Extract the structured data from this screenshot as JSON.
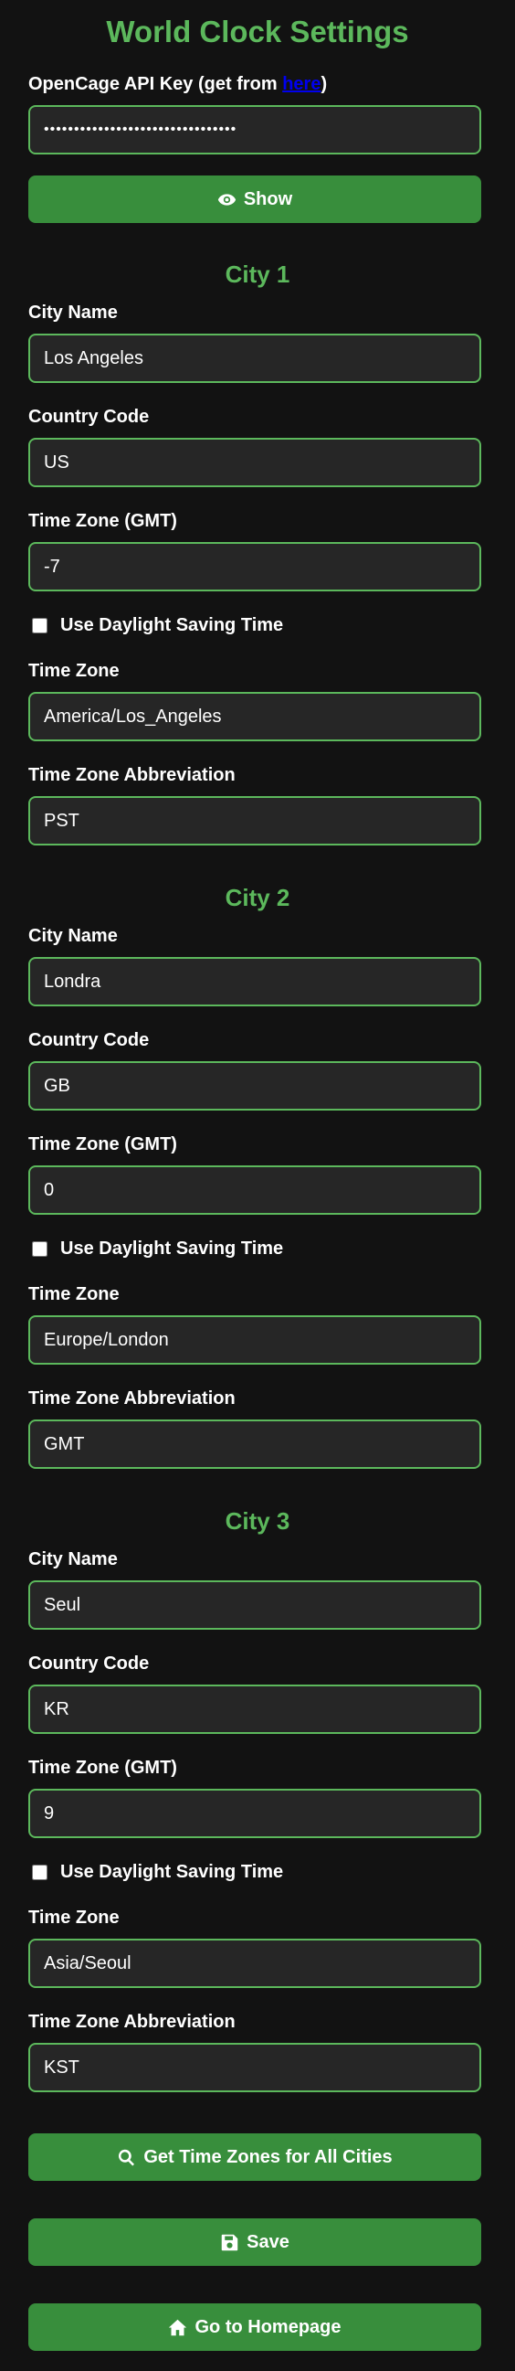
{
  "page": {
    "title": "World Clock Settings"
  },
  "api": {
    "label_prefix": "OpenCage API Key (get from ",
    "link_text": "here",
    "label_suffix": ")",
    "masked_value": "••••••••••••••••••••••••••••••••",
    "show_button": "Show"
  },
  "labels": {
    "city_name": "City Name",
    "country_code": "Country Code",
    "gmt": "Time Zone (GMT)",
    "dst": "Use Daylight Saving Time",
    "time_zone": "Time Zone",
    "abbr": "Time Zone Abbreviation"
  },
  "cities": [
    {
      "heading": "City 1",
      "name": "Los Angeles",
      "country": "US",
      "gmt": "-7",
      "dst": false,
      "timezone": "America/Los_Angeles",
      "abbr": "PST"
    },
    {
      "heading": "City 2",
      "name": "Londra",
      "country": "GB",
      "gmt": "0",
      "dst": false,
      "timezone": "Europe/London",
      "abbr": "GMT"
    },
    {
      "heading": "City 3",
      "name": "Seul",
      "country": "KR",
      "gmt": "9",
      "dst": false,
      "timezone": "Asia/Seoul",
      "abbr": "KST"
    }
  ],
  "actions": {
    "get_zones": "Get Time Zones for All Cities",
    "save": "Save",
    "home": "Go to Homepage"
  },
  "colors": {
    "accent": "#5cb85c",
    "button": "#388e3c",
    "background": "#121212",
    "field": "#262626"
  },
  "icons": {
    "show": "eye-icon",
    "get_zones": "search-icon",
    "save": "save-icon",
    "home": "home-icon"
  }
}
